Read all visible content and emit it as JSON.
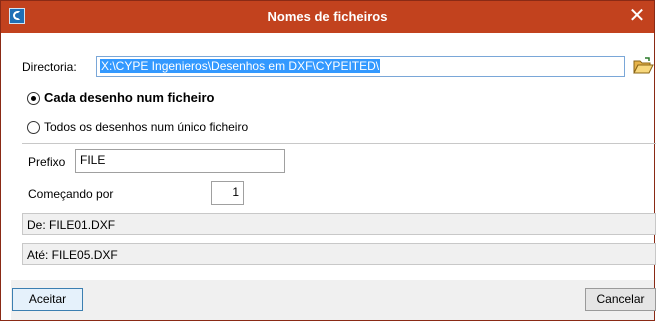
{
  "window": {
    "title": "Nomes de ficheiros",
    "close_symbol": "✕"
  },
  "directory": {
    "label": "Directoria:",
    "value": "X:\\CYPE Ingenieros\\Desenhos em DXF\\CYPEITED\\",
    "browse_icon": "folder-open-icon"
  },
  "options": {
    "each_file": "Cada desenho num ficheiro",
    "single_file": "Todos os desenhos num único ficheiro",
    "selected": "each_file"
  },
  "prefix": {
    "label": "Prefixo",
    "value": "FILE"
  },
  "start": {
    "label": "Começando por",
    "value": "1"
  },
  "range": {
    "from": "De: FILE01.DXF",
    "to": "Até: FILE05.DXF"
  },
  "buttons": {
    "accept": "Aceitar",
    "cancel": "Cancelar"
  },
  "colors": {
    "titlebar": "#c2421e",
    "selection": "#3399ff"
  }
}
